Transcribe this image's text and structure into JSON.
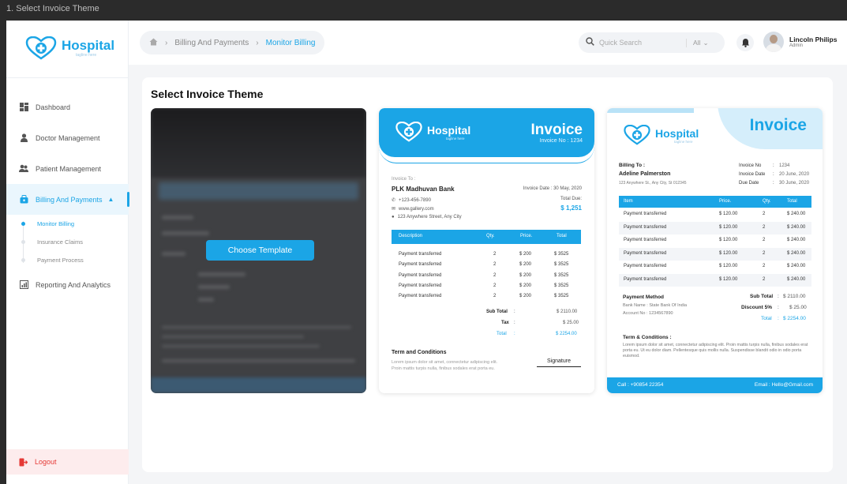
{
  "frame_title": "1. Select Invoice Theme",
  "brand": {
    "name": "Hospital",
    "tagline": "tagline here",
    "accent": "#1ba5e6"
  },
  "sidebar": {
    "items": [
      {
        "label": "Dashboard",
        "icon": "dashboard-icon"
      },
      {
        "label": "Doctor Management",
        "icon": "doctor-icon"
      },
      {
        "label": "Patient Management",
        "icon": "patients-icon"
      },
      {
        "label": "Billing And Payments",
        "icon": "billing-icon",
        "active": true
      },
      {
        "label": "Reporting And Analytics",
        "icon": "chart-icon"
      }
    ],
    "sub_items": [
      "Monitor Billing",
      "Insurance Claims",
      "Payment Process"
    ],
    "logout": "Logout"
  },
  "header": {
    "breadcrumb": [
      "Billing And Payments",
      "Monitor Billing"
    ],
    "search_placeholder": "Quick Search",
    "search_scope": "All",
    "user_name": "Lincoln Philips",
    "user_role": "Admin"
  },
  "main": {
    "title": "Select Invoice Theme",
    "choose_button": "Choose Template"
  },
  "template2": {
    "title": "Invoice",
    "invoice_no": "Invoice No : 1234",
    "invoice_to_label": "Invoice To :",
    "client": "PLK Madhuvan Bank",
    "date": "Invoice Date : 30 May, 2020",
    "phone": "+123-456-7890",
    "web": "www.gallery.com",
    "address": "123 Anywhere Street, Any City",
    "total_due_label": "Total Due:",
    "total_due": "$ 1,251",
    "columns": [
      "Description",
      "Qty.",
      "Price.",
      "Total"
    ],
    "rows": [
      [
        "Payment transferred",
        "2",
        "$ 200",
        "$ 3525"
      ],
      [
        "Payment transferred",
        "2",
        "$ 200",
        "$ 3525"
      ],
      [
        "Payment transferred",
        "2",
        "$ 200",
        "$ 3525"
      ],
      [
        "Payment transferred",
        "2",
        "$ 200",
        "$ 3525"
      ],
      [
        "Payment transferred",
        "2",
        "$ 200",
        "$ 3525"
      ]
    ],
    "subtotal_label": "Sub Total",
    "subtotal": "$ 2110.00",
    "tax_label": "Tax",
    "tax": "$ 25.00",
    "total_label": "Total",
    "total": "$ 2254.00",
    "terms_title": "Term and Conditions",
    "terms_body": "Lorem ipsum dolor sit amet, connectetur adipiscing elit. Proin mattis turpis nulla, finibus sodales erat porta eu.",
    "signature": "Signature"
  },
  "template3": {
    "title": "Invoice",
    "billing_to_label": "Billing To :",
    "client": "Adeline Palmerston",
    "address": "123 Anywhere St., Any City, St 012345",
    "meta": [
      {
        "label": "Invoice No",
        "value": "1234"
      },
      {
        "label": "Invoice Date",
        "value": "20 June, 2020"
      },
      {
        "label": "Due Date",
        "value": "30 June, 2020"
      }
    ],
    "columns": [
      "Item",
      "Price.",
      "Qty.",
      "Total"
    ],
    "rows": [
      [
        "Payment transferred",
        "$ 120.00",
        "2",
        "$ 240.00"
      ],
      [
        "Payment transferred",
        "$ 120.00",
        "2",
        "$ 240.00"
      ],
      [
        "Payment transferred",
        "$ 120.00",
        "2",
        "$ 240.00"
      ],
      [
        "Payment transferred",
        "$ 120.00",
        "2",
        "$ 240.00"
      ],
      [
        "Payment transferred",
        "$ 120.00",
        "2",
        "$ 240.00"
      ],
      [
        "Payment transferred",
        "$ 120.00",
        "2",
        "$ 240.00"
      ]
    ],
    "payment_method_label": "Payment Method",
    "bank_name": "Bank Name : State Bank Of India",
    "account_no": "Account No : 1234567890",
    "subtotal_label": "Sub Total",
    "subtotal": "$ 2110.00",
    "discount_label": "Discount 5%",
    "discount": "$ 25.00",
    "total_label": "Total",
    "total": "$ 2254.00",
    "terms_title": "Term & Conditions :",
    "terms_body": "Lorem ipsum dolor sit amet, connectetur adipiscing elit. Proin mattis turpis nulla, finibus sodales erat porta eu. Ut eu dolor diam. Pellentesque quis mollis nulla. Suspendisse blandit odio in odio porta euismod.",
    "call": "Call : +90854 22354",
    "email": "Email : Hello@Gmail.com"
  }
}
